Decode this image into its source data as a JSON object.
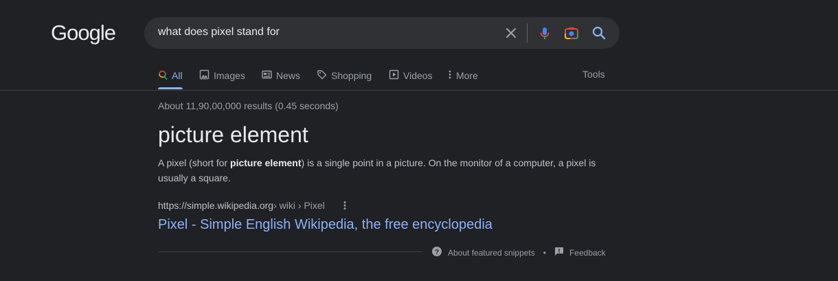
{
  "logo": {
    "text": "Google"
  },
  "search": {
    "query": "what does pixel stand for"
  },
  "tabs": [
    {
      "label": "All",
      "icon": "search-icon"
    },
    {
      "label": "Images",
      "icon": "image-icon"
    },
    {
      "label": "News",
      "icon": "news-icon"
    },
    {
      "label": "Shopping",
      "icon": "tag-icon"
    },
    {
      "label": "Videos",
      "icon": "play-icon"
    },
    {
      "label": "More",
      "icon": "vertical-dots-icon"
    }
  ],
  "tools_label": "Tools",
  "stats": "About 11,90,00,000 results (0.45 seconds)",
  "snippet": {
    "title": "picture element",
    "text_before": "A pixel (short for ",
    "text_bold": "picture element",
    "text_after": ") is a single point in a picture. On the monitor of a computer, a pixel is usually a square."
  },
  "result": {
    "url_domain": "https://simple.wikipedia.org",
    "url_path": " › wiki › Pixel",
    "title": "Pixel - Simple English Wikipedia, the free encyclopedia"
  },
  "footer": {
    "about_label": "About featured snippets",
    "separator": "•",
    "feedback_label": "Feedback"
  },
  "colors": {
    "background": "#202124",
    "link": "#8ab4f8",
    "searchbox": "#303134"
  }
}
